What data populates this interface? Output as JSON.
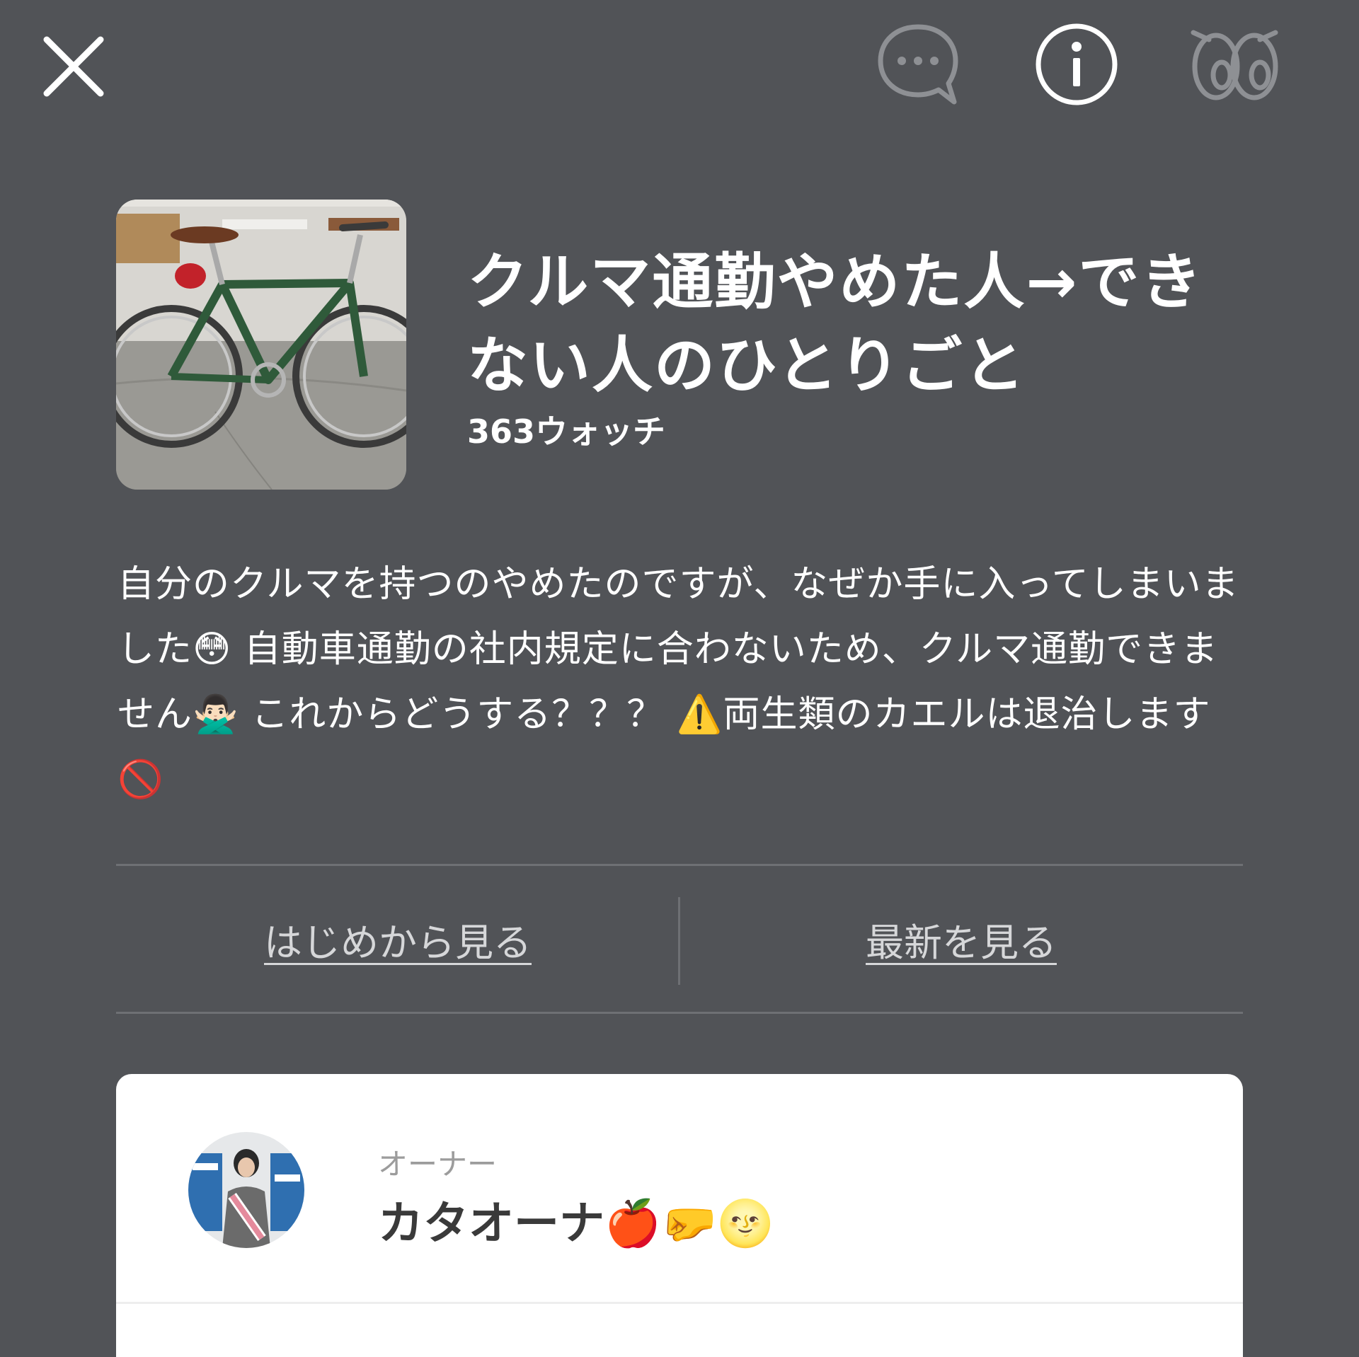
{
  "topbar": {
    "close_icon": "close-icon",
    "chat_icon": "chat-bubble-icon",
    "info_icon": "info-icon",
    "watch_icon": "eyes-icon"
  },
  "header": {
    "title": "クルマ通勤やめた人→できない人のひとりごと",
    "watch_count": "363ウォッチ",
    "cover_image": "bicycle-photo"
  },
  "description": "自分のクルマを持つのやめたのですが、なぜか手に入ってしまいました😳 自動車通勤の社内規定に合わないため、クルマ通勤できません🙅🏻‍♂️ これからどうする？？？ ⚠️両生類のカエルは退治します🚫",
  "nav": {
    "start_label": "はじめから見る",
    "latest_label": "最新を見る"
  },
  "owner": {
    "role": "オーナー",
    "name": "カタオーナ🍎🤛🌝",
    "avatar": "owner-avatar-photo"
  },
  "colors": {
    "background": "#515357",
    "divider": "#6e7074",
    "card": "#ffffff",
    "role_text": "#9c9c9c",
    "name_text": "#3a3a3a"
  }
}
